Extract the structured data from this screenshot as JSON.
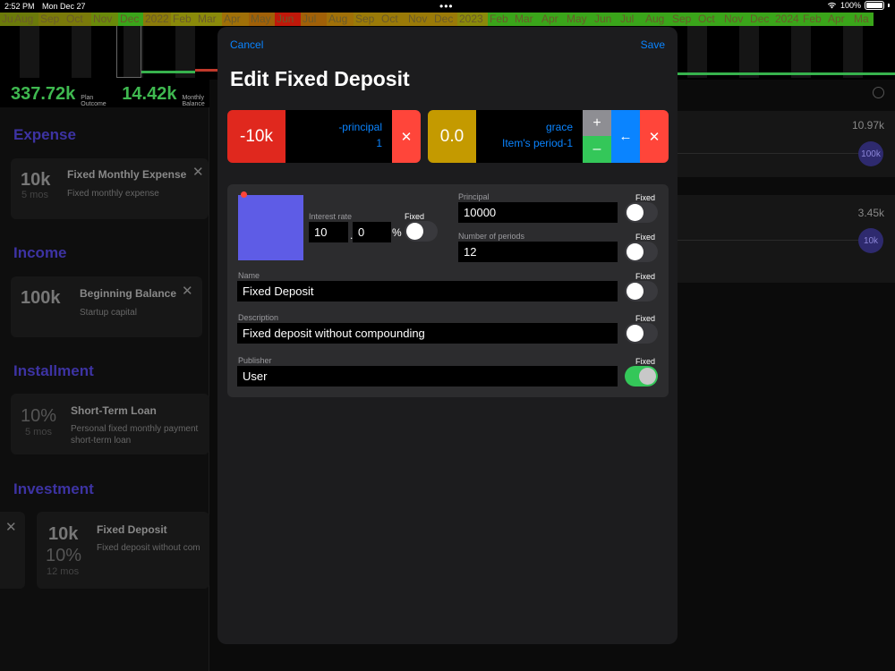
{
  "status": {
    "time": "2:52 PM",
    "date": "Mon Dec 27",
    "battery": "100%"
  },
  "timeline": [
    {
      "label": "Jul",
      "bg": "#6b7a0a",
      "w": 14
    },
    {
      "label": "Aug",
      "bg": "#6b7a0a",
      "w": 29
    },
    {
      "label": "Sep",
      "bg": "#7a7a0a",
      "w": 29
    },
    {
      "label": "Oct",
      "bg": "#7a7a0a",
      "w": 30
    },
    {
      "label": "Nov",
      "bg": "#6a8a0a",
      "w": 30
    },
    {
      "label": "Dec",
      "bg": "#3aa51a",
      "w": 28
    },
    {
      "label": "2022",
      "bg": "#8a7a0a",
      "w": 31
    },
    {
      "label": "Feb",
      "bg": "#8a8a0a",
      "w": 28
    },
    {
      "label": "Mar",
      "bg": "#8a8a0a",
      "w": 29
    },
    {
      "label": "Apr",
      "bg": "#a07008",
      "w": 30
    },
    {
      "label": "May",
      "bg": "#a06008",
      "w": 29
    },
    {
      "label": "Jun",
      "bg": "#c0180a",
      "w": 29
    },
    {
      "label": "Jul",
      "bg": "#a06008",
      "w": 29
    },
    {
      "label": "Aug",
      "bg": "#a07008",
      "w": 30
    },
    {
      "label": "Sep",
      "bg": "#9a7a08",
      "w": 29
    },
    {
      "label": "Oct",
      "bg": "#9a7a08",
      "w": 30
    },
    {
      "label": "Nov",
      "bg": "#9a7a08",
      "w": 29
    },
    {
      "label": "Dec",
      "bg": "#9a7a08",
      "w": 28
    },
    {
      "label": "2023",
      "bg": "#8a8a0a",
      "w": 34
    },
    {
      "label": "Feb",
      "bg": "#3aa51a",
      "w": 28
    },
    {
      "label": "Mar",
      "bg": "#3aa51a",
      "w": 30
    },
    {
      "label": "Apr",
      "bg": "#3aa51a",
      "w": 28
    },
    {
      "label": "May",
      "bg": "#3aa51a",
      "w": 31
    },
    {
      "label": "Jun",
      "bg": "#3aa51a",
      "w": 29
    },
    {
      "label": "Jul",
      "bg": "#3aa51a",
      "w": 28
    },
    {
      "label": "Aug",
      "bg": "#3aa51a",
      "w": 30
    },
    {
      "label": "Sep",
      "bg": "#3aa51a",
      "w": 29
    },
    {
      "label": "Oct",
      "bg": "#3aa51a",
      "w": 29
    },
    {
      "label": "Nov",
      "bg": "#3aa51a",
      "w": 29
    },
    {
      "label": "Dec",
      "bg": "#3aa51a",
      "w": 28
    },
    {
      "label": "2024",
      "bg": "#3aa51a",
      "w": 31
    },
    {
      "label": "Feb",
      "bg": "#3aa51a",
      "w": 28
    },
    {
      "label": "Apr",
      "bg": "#3aa51a",
      "w": 29
    },
    {
      "label": "Ma",
      "bg": "#3aa51a",
      "w": 24
    }
  ],
  "summary": {
    "plan_value": "337.72k",
    "plan_label": "Plan Outcome",
    "monthly_value": "14.42k",
    "monthly_label": "Monthly Balance"
  },
  "sections": {
    "expense": "Expense",
    "income": "Income",
    "installment": "Installment",
    "investment": "Investment"
  },
  "cards": {
    "expense": {
      "value": "10k",
      "sub": "5 mos",
      "title": "Fixed Monthly Expense",
      "desc": "Fixed monthly expense"
    },
    "income": {
      "value": "100k",
      "title": "Beginning Balance",
      "desc": "Startup capital"
    },
    "installment": {
      "value": "10%",
      "sub": "5 mos",
      "title": "Short-Term Loan",
      "desc": "Personal fixed monthly payment short-term loan"
    },
    "investment": {
      "value": "10k",
      "value2": "10%",
      "sub": "12 mos",
      "title": "Fixed Deposit",
      "desc": "Fixed deposit without com"
    }
  },
  "right_rows": [
    {
      "value": "10.97k",
      "circle": "100k"
    },
    {
      "value": "3.45k",
      "circle": "10k"
    }
  ],
  "modal": {
    "cancel": "Cancel",
    "save": "Save",
    "title": "Edit Fixed Deposit",
    "principal_block": {
      "amount": "-10k",
      "line1": "-principal",
      "line2": "1"
    },
    "grace_block": {
      "amount": "0.0",
      "line1": "grace",
      "line2": "Item's period-1"
    },
    "form": {
      "interest_label": "Interest rate",
      "interest_whole": "10",
      "interest_decimal": "0",
      "percent": "%",
      "fixed": "Fixed",
      "principal_label": "Principal",
      "principal_value": "10000",
      "periods_label": "Number of periods",
      "periods_value": "12",
      "name_label": "Name",
      "name_value": "Fixed Deposit",
      "desc_label": "Description",
      "desc_value": "Fixed deposit without compounding",
      "publisher_label": "Publisher",
      "publisher_value": "User"
    },
    "swatch_color": "#5e5ce6"
  }
}
